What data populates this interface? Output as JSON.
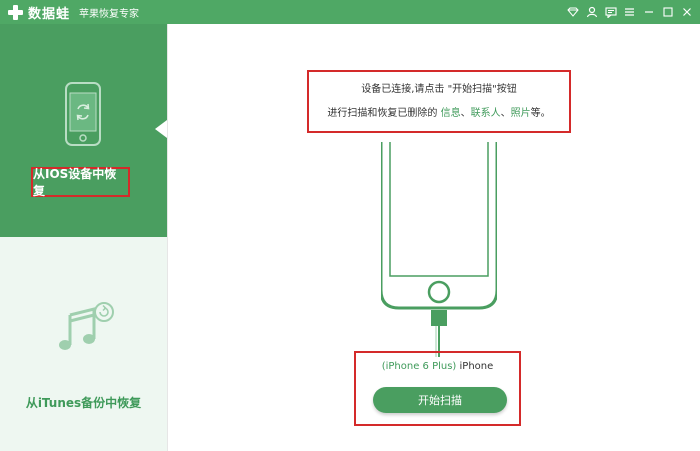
{
  "titlebar": {
    "app_name": "数据蛙",
    "app_subtitle": "苹果恢复专家",
    "controls": [
      "diamond-icon",
      "user-icon",
      "message-icon",
      "menu-icon",
      "minimize-icon",
      "maximize-icon",
      "close-icon"
    ]
  },
  "sidebar": {
    "items": [
      {
        "label": "从IOS设备中恢复",
        "icon": "phone-refresh-icon",
        "active": true
      },
      {
        "label": "从iTunes备份中恢复",
        "icon": "music-refresh-icon",
        "active": false
      }
    ]
  },
  "main": {
    "prompt_line1": "设备已连接,请点击 \"开始扫描\"按钮",
    "prompt_line2_prefix": "进行扫描和恢复已删除的 ",
    "prompt_line2_info": "信息",
    "prompt_line2_sep1": "、",
    "prompt_line2_contacts": "联系人",
    "prompt_line2_sep2": "、",
    "prompt_line2_photos": "照片",
    "prompt_line2_suffix": "等。",
    "device_model": "(iPhone 6 Plus)",
    "device_name": "iPhone",
    "start_button": "开始扫描"
  },
  "colors": {
    "brand_green": "#4a9e60",
    "sidebar_bg": "#eef7f1",
    "highlight_red": "#d42a2a"
  }
}
